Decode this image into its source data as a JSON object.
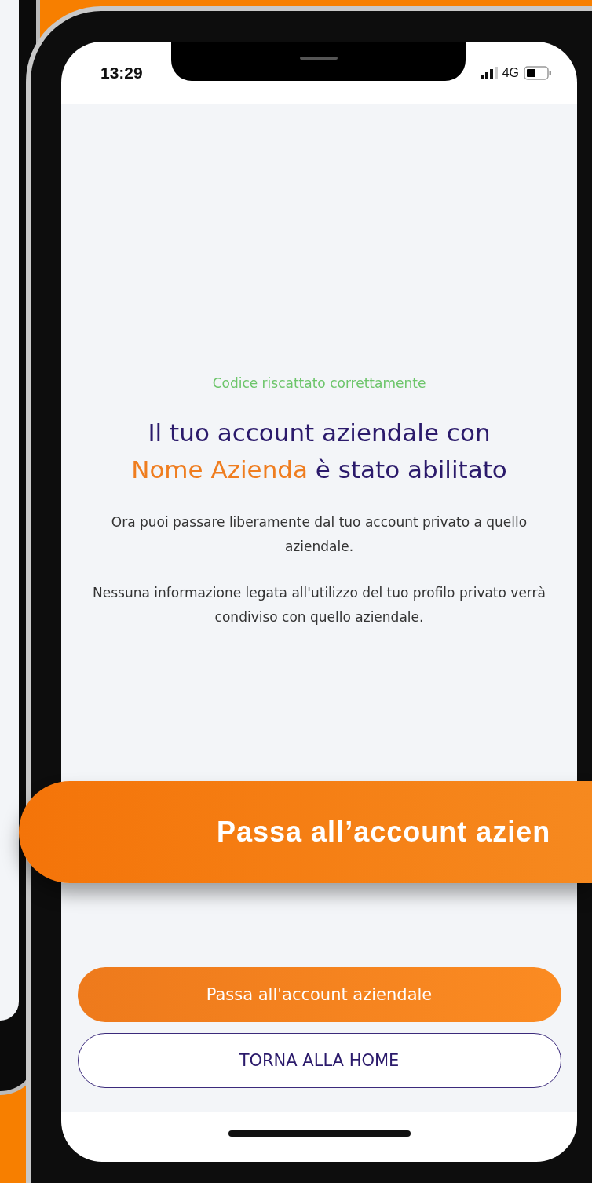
{
  "status_bar": {
    "time": "13:29",
    "network": "4G"
  },
  "message": {
    "status": "Codice riscattato correttamente",
    "title": [
      {
        "text": "Il tuo account aziendale con ",
        "highlight": false
      },
      {
        "text": "Nome Azienda",
        "highlight": true
      },
      {
        "text": " è stato abilitato",
        "highlight": false
      }
    ],
    "paragraphs": [
      "Ora puoi passare liberamente dal tuo account privato a quello aziendale.",
      "Nessuna informazione legata all'utilizzo del tuo profilo privato verrà condiviso con quello aziendale."
    ]
  },
  "buttons": [
    {
      "label": "Passa all'account aziendale",
      "kind": "primary"
    },
    {
      "label": "TORNA ALLA HOME",
      "kind": "outline"
    }
  ],
  "callout": {
    "label": "Passa all’account azien"
  }
}
